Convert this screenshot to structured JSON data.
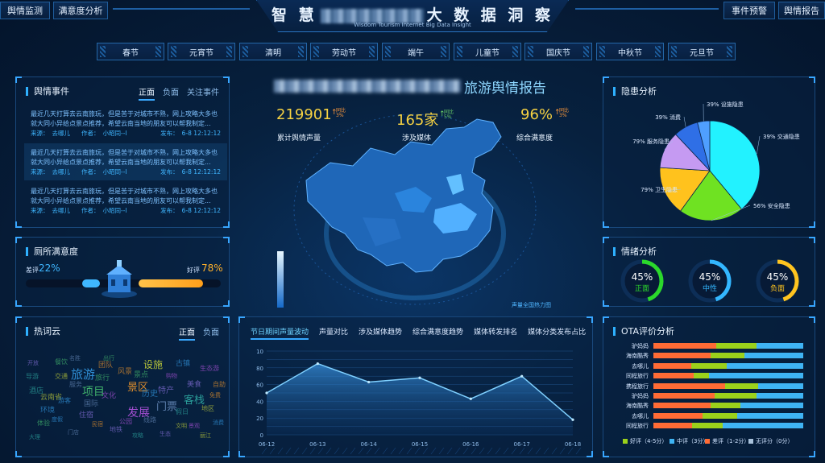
{
  "header": {
    "title_left": "智 慧",
    "title_right": "大 数 据 洞 察",
    "subtitle": "Wisdom Tourism Internet Big Data Insight",
    "left_buttons": [
      "舆情监测",
      "满意度分析"
    ],
    "right_buttons": [
      "事件预警",
      "舆情报告"
    ]
  },
  "holidays": [
    "春节",
    "元宵节",
    "清明",
    "劳动节",
    "端午",
    "儿童节",
    "国庆节",
    "中秋节",
    "元旦节"
  ],
  "events": {
    "title": "舆情事件",
    "tabs": [
      "正面",
      "负面",
      "关注事件"
    ],
    "items": [
      {
        "text": "最近几天打算去云南旅玩，但是苦于对城市不熟，网上攻略大多也就大同小异给点景点推荐，希望云南当地的朋友可以帮我制定...",
        "source_label": "来源：",
        "source": "去哪儿",
        "author_label": "作者：",
        "author": "小昭同--l",
        "time_label": "发布：",
        "time": "6-8 12:12:12"
      },
      {
        "text": "最近几天打算去云南旅玩，但是苦于对城市不熟，网上攻略大多也就大同小异给点景点推荐，希望云南当地的朋友可以帮我制定...",
        "source_label": "来源：",
        "source": "去哪儿",
        "author_label": "作者：",
        "author": "小昭同--l",
        "time_label": "发布：",
        "time": "6-8 12:12:12"
      },
      {
        "text": "最近几天打算去云南旅玩，但是苦于对城市不熟，网上攻略大多也就大同小异给点景点推荐，希望云南当地的朋友可以帮我制定...",
        "source_label": "来源：",
        "source": "去哪儿",
        "author_label": "作者：",
        "author": "小昭同--l",
        "time_label": "发布：",
        "time": "6-8 12:12:12"
      }
    ]
  },
  "toilet": {
    "title": "厕所满意度",
    "bad_label": "差评",
    "bad_pct": "22%",
    "good_label": "好评",
    "good_pct": "78%",
    "bad_value": 22,
    "good_value": 78
  },
  "wordcloud": {
    "title": "热词云",
    "tabs": [
      "正面",
      "负面"
    ],
    "words": [
      "旅游",
      "项目",
      "景区",
      "发展",
      "门票",
      "客栈",
      "设施",
      "特产",
      "历史",
      "旅行",
      "风景",
      "文化",
      "国际",
      "酒店",
      "云南省",
      "住宿",
      "环境",
      "景点",
      "团队",
      "生态游",
      "服务",
      "导游",
      "交通",
      "美食",
      "游客",
      "体验",
      "自助",
      "公园",
      "线路",
      "假日",
      "地区",
      "地铁",
      "古镇",
      "餐饮",
      "民宿",
      "景观",
      "门店",
      "大理",
      "丽江",
      "生态",
      "度假",
      "出行",
      "免费",
      "购物",
      "名胜",
      "攻略",
      "文明",
      "开放",
      "消费"
    ]
  },
  "report": {
    "title": "旅游舆情报告",
    "legend": "声量全国热力图"
  },
  "stats": [
    {
      "value": "219901",
      "label": "累计舆情声量",
      "trend_label": "同比",
      "trend": "3%"
    },
    {
      "value": "165家",
      "label": "涉及媒体",
      "trend_label": "同比",
      "trend": "5%"
    },
    {
      "value": "96%",
      "label": "综合满意度",
      "trend_label": "同比",
      "trend": "3%"
    }
  ],
  "hazard": {
    "title": "隐患分析",
    "chart_data": {
      "type": "pie",
      "slices": [
        {
          "name": "交通隐患",
          "label": "39% 交通隐患",
          "value": 39,
          "color": "#22f2ff"
        },
        {
          "name": "安全隐患",
          "label": "56% 安全隐患",
          "value": 21,
          "color": "#6fe222"
        },
        {
          "name": "卫生隐患",
          "label": "79% 卫生隐患",
          "value": 16,
          "color": "#ffc21d"
        },
        {
          "name": "服务隐患",
          "label": "79% 服务隐患",
          "value": 12,
          "color": "#c59af2"
        },
        {
          "name": "消费",
          "label": "39% 消费",
          "value": 8,
          "color": "#2f6fe6"
        },
        {
          "name": "设施隐患",
          "label": "39% 设施隐患",
          "value": 4,
          "color": "#4f9fff"
        }
      ]
    }
  },
  "emotion": {
    "title": "情绪分析",
    "items": [
      {
        "pct": "45%",
        "label": "正面",
        "value": 45,
        "color": "#2bd82b"
      },
      {
        "pct": "45%",
        "label": "中性",
        "value": 45,
        "color": "#33b7ff"
      },
      {
        "pct": "45%",
        "label": "负面",
        "value": 45,
        "color": "#ffc41f"
      }
    ]
  },
  "trend": {
    "tabs": [
      "节日期间声量波动",
      "声量对比",
      "涉及媒体趋势",
      "综合满意度趋势",
      "媒体转发排名",
      "媒体分类发布占比"
    ],
    "chart_data": {
      "type": "area",
      "x": [
        "06-12",
        "06-13",
        "06-14",
        "06-15",
        "06-16",
        "06-17",
        "06-18"
      ],
      "y": [
        50,
        85,
        63,
        68,
        43,
        70,
        18
      ],
      "ylim": [
        0,
        100
      ],
      "yticks": [
        0,
        10,
        20,
        30,
        40,
        50,
        60,
        70,
        80,
        90,
        100
      ],
      "ytick_labels": [
        "0",
        "",
        "20",
        "",
        "40",
        "",
        "60",
        "",
        "80",
        "",
        "10"
      ]
    }
  },
  "ota": {
    "title": "OTA评价分析",
    "chart_data": {
      "type": "bar",
      "stacked": true,
      "categories": [
        "驴妈妈",
        "海南酷秀",
        "去哪儿",
        "同程旅行",
        "携程旅行",
        "驴妈妈",
        "海南酷秀",
        "去哪儿",
        "同程旅行"
      ],
      "series": [
        {
          "name": "差评（1-2分）",
          "color": "#ff6b35",
          "values": [
            42,
            38,
            25,
            27,
            48,
            41,
            38,
            33,
            26
          ]
        },
        {
          "name": "好评（4-5分）",
          "color": "#9bd11b",
          "values": [
            27,
            23,
            24,
            10,
            22,
            28,
            20,
            23,
            20
          ]
        },
        {
          "name": "中评（3分）",
          "color": "#3fb4f4",
          "values": [
            31,
            39,
            51,
            63,
            30,
            31,
            42,
            44,
            54
          ]
        }
      ]
    },
    "legend": [
      "好评（4-5分）",
      "中评（3分）",
      "差评（1-2分）",
      "无评分（0分）"
    ],
    "legend_colors": [
      "#9bd11b",
      "#3fb4f4",
      "#ff6b35",
      "#a9c2dc"
    ]
  }
}
